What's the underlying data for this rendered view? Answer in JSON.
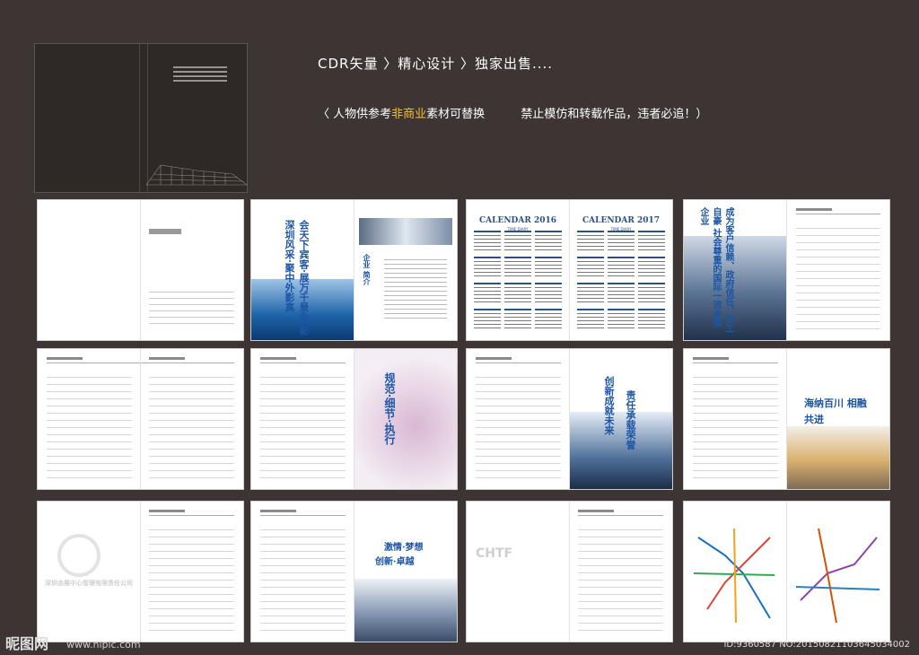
{
  "header": {
    "title": "CDR矢量 〉精心设计 〉独家出售....",
    "note_prefix": "〈 人物供参考",
    "note_highlight": "非商业",
    "note_suffix": "素材可替换",
    "note_warning": "禁止模仿和转载作品，违者必追！）"
  },
  "pages": {
    "p2_text": "会天下宾客·展万千景象 彰深圳风采·聚中外影真",
    "p2_label": "企业 简介",
    "p3_title_2016": "CALENDAR 2016",
    "p3_title_2017": "CALENDAR 2017",
    "p3_sub": "TIME DIARY",
    "p4_text": "成为客户信赖、政府信任、员工自豪 社会尊重的国际一流会展企业",
    "p6_text": "规范·细节·执行",
    "p7_text_1": "创新成就未来",
    "p7_text_2": "责任承载荣誉",
    "p8_text": "海纳百川 相融共进",
    "p11_text_1": "激情·梦想",
    "p11_text_2": "创新·卓越",
    "p12_logo": "CHTF",
    "p10_corp": "深圳会展中心管理有限责任公司"
  },
  "footer": {
    "site": "昵图网",
    "url": "www.nipic.com",
    "id": "ID:9360587 NO:20150821103645034002"
  }
}
